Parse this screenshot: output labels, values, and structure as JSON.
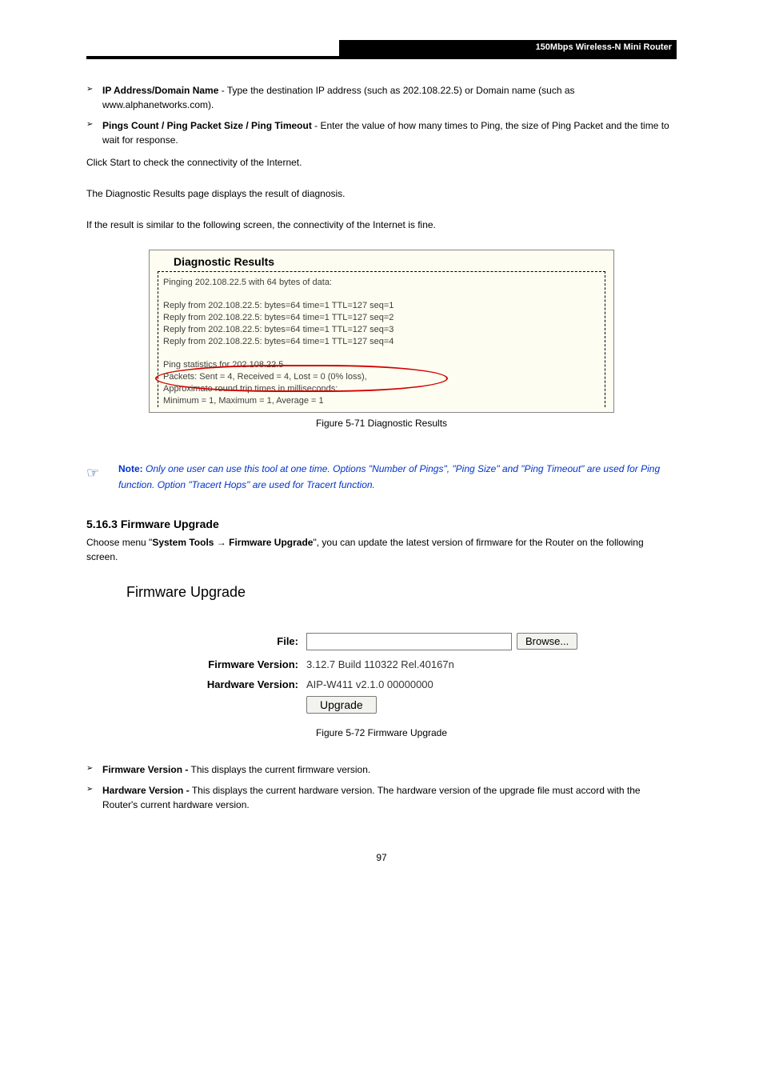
{
  "header": {
    "title": "150Mbps Wireless-N Mini Router"
  },
  "bullets": [
    {
      "term": "IP Address/Domain Name",
      "desc": " - Type the destination IP address (such as 202.108.22.5) or Domain name (such as www.alphanetworks.com)."
    },
    {
      "term": "Pings Count / Ping Packet Size / Ping Timeout",
      "desc": " - Enter the value of how many times to Ping, the size of Ping Packet and the time to wait for response."
    }
  ],
  "click_start": "Click Start to check the connectivity of the Internet.",
  "diag_area": "The Diagnostic Results page displays the result of diagnosis.",
  "diag_success": "If the result is similar to the following screen, the connectivity of the Internet is fine.",
  "diag_caption": "Figure 5-71 Diagnostic Results",
  "diag": {
    "title": "Diagnostic Results",
    "line1": "Pinging 202.108.22.5 with 64 bytes of data:",
    "reply1": "Reply from 202.108.22.5:  bytes=64  time=1  TTL=127  seq=1",
    "reply2": "Reply from 202.108.22.5:  bytes=64  time=1  TTL=127  seq=2",
    "reply3": "Reply from 202.108.22.5:  bytes=64  time=1  TTL=127  seq=3",
    "reply4": "Reply from 202.108.22.5:  bytes=64  time=1  TTL=127  seq=4",
    "stats1": "Ping statistics for 202.108.22.5",
    "stats2": "Packets: Sent = 4, Received = 4, Lost = 0 (0% loss),",
    "approx": "Approximate round trip times in milliseconds:",
    "minmax": "Minimum = 1, Maximum = 1, Average = 1"
  },
  "note": {
    "label": "Note:",
    "text": " Only one user can use this tool at one time. Options \"Number of Pings\", \"Ping Size\" and \"Ping Timeout\" are used for Ping function. Option \"Tracert Hops\" are used for Tracert function."
  },
  "section": {
    "num": "5.16.3  Firmware Upgrade",
    "desc_pre": "Choose menu \"",
    "desc_bold": "System Tools → Firmware Upgrade",
    "desc_post": "\", you can update the latest version of firmware for the Router on the following screen."
  },
  "fw": {
    "title": "Firmware Upgrade",
    "file_label": "File:",
    "file_value": "",
    "browse": "Browse...",
    "fv_label": "Firmware Version:",
    "fv_value": "3.12.7 Build 110322 Rel.40167n",
    "hv_label": "Hardware Version:",
    "hv_value": "AIP-W411 v2.1.0 00000000",
    "upgrade": "Upgrade"
  },
  "fig572": "Figure 5-72 Firmware Upgrade",
  "bullets2": [
    {
      "term": "Firmware Version -",
      "desc": " This displays the current firmware version."
    },
    {
      "term": "Hardware Version -",
      "desc": " This displays the current hardware version. The hardware version of the upgrade file must accord with the Router's current hardware version."
    }
  ],
  "page": "97"
}
